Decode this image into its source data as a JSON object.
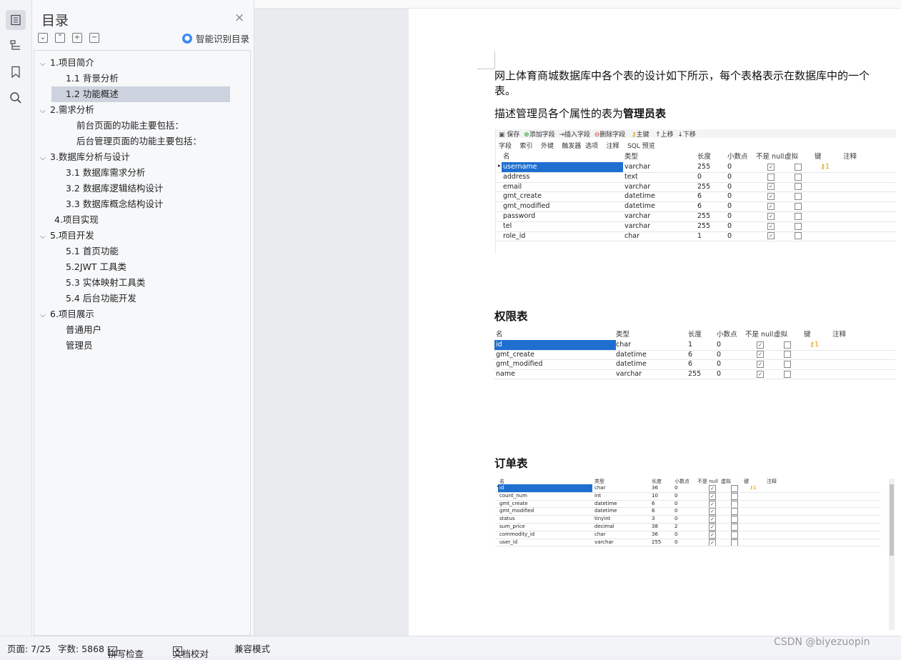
{
  "toc": {
    "title": "目录",
    "close": "×",
    "smart_label": "智能识别目录",
    "items": [
      {
        "label": "1.项目简介",
        "expanded": true
      },
      {
        "label": "1.1 背景分析"
      },
      {
        "label": "1.2 功能概述",
        "selected": true
      },
      {
        "label": "2.需求分析",
        "expanded": true
      },
      {
        "label": "前台页面的功能主要包括："
      },
      {
        "label": "后台管理页面的功能主要包括："
      },
      {
        "label": "3.数据库分析与设计",
        "expanded": true
      },
      {
        "label": "3.1 数据库需求分析"
      },
      {
        "label": "3.2 数据库逻辑结构设计"
      },
      {
        "label": "3.3 数据库概念结构设计"
      },
      {
        "label": "4.项目实现"
      },
      {
        "label": "5.项目开发",
        "expanded": true
      },
      {
        "label": "5.1 首页功能"
      },
      {
        "label": "5.2JWT 工具类"
      },
      {
        "label": "5.3 实体映射工具类"
      },
      {
        "label": "5.4 后台功能开发"
      },
      {
        "label": "6.项目展示",
        "expanded": true
      },
      {
        "label": "普通用户"
      },
      {
        "label": "管理员"
      }
    ]
  },
  "doc": {
    "intro_line1": "网上体育商城数据库中各个表的设计如下所示，每个表格表示在数据库中的一个",
    "intro_line2": "表。",
    "admin_prefix": "描述管理员各个属性的表为",
    "admin_bold": "管理员表",
    "perm_heading": "权限表",
    "order_heading": "订单表",
    "toolbar": {
      "save": "保存",
      "add": "添加字段",
      "insert": "插入字段",
      "delete": "删除字段",
      "pk": "主键",
      "up": "上移",
      "down": "下移"
    },
    "tabs": [
      "字段",
      "索引",
      "外键",
      "触发器",
      "选项",
      "注释",
      "SQL 预览"
    ],
    "headers": [
      "名",
      "类型",
      "长度",
      "小数点",
      "不是 null",
      "虚拟",
      "键",
      "注释"
    ],
    "admin_rows": [
      {
        "name": "username",
        "type": "varchar",
        "len": "255",
        "dec": "0",
        "notnull": true,
        "key": "1"
      },
      {
        "name": "address",
        "type": "text",
        "len": "0",
        "dec": "0",
        "notnull": false
      },
      {
        "name": "email",
        "type": "varchar",
        "len": "255",
        "dec": "0",
        "notnull": true
      },
      {
        "name": "gmt_create",
        "type": "datetime",
        "len": "6",
        "dec": "0",
        "notnull": true
      },
      {
        "name": "gmt_modified",
        "type": "datetime",
        "len": "6",
        "dec": "0",
        "notnull": true
      },
      {
        "name": "password",
        "type": "varchar",
        "len": "255",
        "dec": "0",
        "notnull": true
      },
      {
        "name": "tel",
        "type": "varchar",
        "len": "255",
        "dec": "0",
        "notnull": true
      },
      {
        "name": "role_id",
        "type": "char",
        "len": "1",
        "dec": "0",
        "notnull": true
      }
    ],
    "perm_rows": [
      {
        "name": "id",
        "type": "char",
        "len": "1",
        "dec": "0",
        "notnull": true,
        "key": "1"
      },
      {
        "name": "gmt_create",
        "type": "datetime",
        "len": "6",
        "dec": "0",
        "notnull": true
      },
      {
        "name": "gmt_modified",
        "type": "datetime",
        "len": "6",
        "dec": "0",
        "notnull": true
      },
      {
        "name": "name",
        "type": "varchar",
        "len": "255",
        "dec": "0",
        "notnull": true
      }
    ],
    "order_rows": [
      {
        "name": "id",
        "type": "char",
        "len": "36",
        "dec": "0",
        "notnull": true,
        "key": "1"
      },
      {
        "name": "count_num",
        "type": "int",
        "len": "10",
        "dec": "0",
        "notnull": true
      },
      {
        "name": "gmt_create",
        "type": "datetime",
        "len": "6",
        "dec": "0",
        "notnull": true
      },
      {
        "name": "gmt_modified",
        "type": "datetime",
        "len": "6",
        "dec": "0",
        "notnull": true
      },
      {
        "name": "status",
        "type": "tinyint",
        "len": "3",
        "dec": "0",
        "notnull": true
      },
      {
        "name": "sum_price",
        "type": "decimal",
        "len": "38",
        "dec": "2",
        "notnull": true
      },
      {
        "name": "commodity_id",
        "type": "char",
        "len": "36",
        "dec": "0",
        "notnull": true
      },
      {
        "name": "user_id",
        "type": "varchar",
        "len": "255",
        "dec": "0",
        "notnull": true
      }
    ]
  },
  "status": {
    "page": "页面: 7/25",
    "words": "字数: 5868",
    "spell": "拼写检查",
    "proof": "文档校对",
    "compat": "兼容模式"
  },
  "watermark": "CSDN @biyezuopin"
}
